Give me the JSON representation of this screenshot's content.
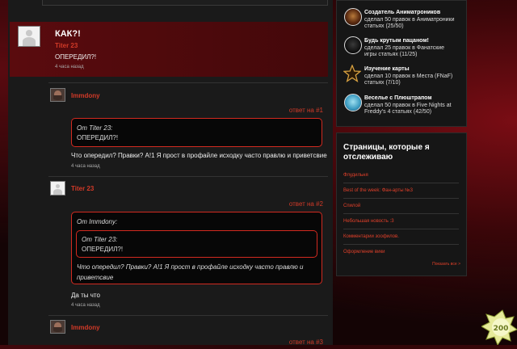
{
  "comments": {
    "first": {
      "title": "КАК?!",
      "author": "Titer 23",
      "text": "ОПЕРЕДИЛ?!",
      "time": "4 часа назад"
    },
    "reply1": {
      "author": "Immdony",
      "reply_to": "ответ на #1",
      "quote_header": "От Titer 23:",
      "quote_text": "ОПЕРЕДИЛ?!",
      "text": "Что опередил? Правки? А!1 Я прост в профайле исходку часто правлю и приветсвие",
      "time": "4 часа назад"
    },
    "reply2": {
      "author": "Titer 23",
      "reply_to": "ответ на #2",
      "quote_header": "От Immdony:",
      "inner_quote_header": "От Titer 23:",
      "inner_quote_text": "ОПЕРЕДИЛ?!",
      "quote_text_line1": "Что опередил? Правки? А!1 Я прост в профайле исходку часто правлю и",
      "quote_text_line2": "приветсвие",
      "text": "Да ты что",
      "time": "4 часа назад"
    },
    "reply3": {
      "author": "Immdony",
      "reply_to": "ответ на #3"
    }
  },
  "badges": [
    {
      "title": "Создатель Аниматроников",
      "desc1": "сделал 50 правок в Аниматроники",
      "desc2": "статьях (25/50)",
      "icon": "animatronic-icon"
    },
    {
      "title": "Будь крутым пацаном!",
      "desc1": "сделал 25 правок в Фанатские",
      "desc2": "игры статьях (11/25)",
      "icon": "cool-guy-icon"
    },
    {
      "title": "Изучение карты",
      "desc1": "сделал 10 правок в Места (FNaF)",
      "desc2": "статьях (7/10)",
      "icon": "star-map-icon"
    },
    {
      "title": "Веселье с Плюштрапом",
      "desc1": "сделал 50 правок в Five Nights at",
      "desc2": "Freddy's 4 статьях (42/50)",
      "icon": "plushtrap-icon"
    }
  ],
  "followed": {
    "title_line1": "Страницы, которые я",
    "title_line2": "отслеживаю",
    "links": [
      "Флудильня",
      "Best of the week: Фан-арты №3",
      "Спилой",
      "Небольшая новость :3",
      "Комментарии зоофилов.",
      "Оформление вики"
    ],
    "show_all": "Показать все >"
  },
  "mascot_badge": "200"
}
